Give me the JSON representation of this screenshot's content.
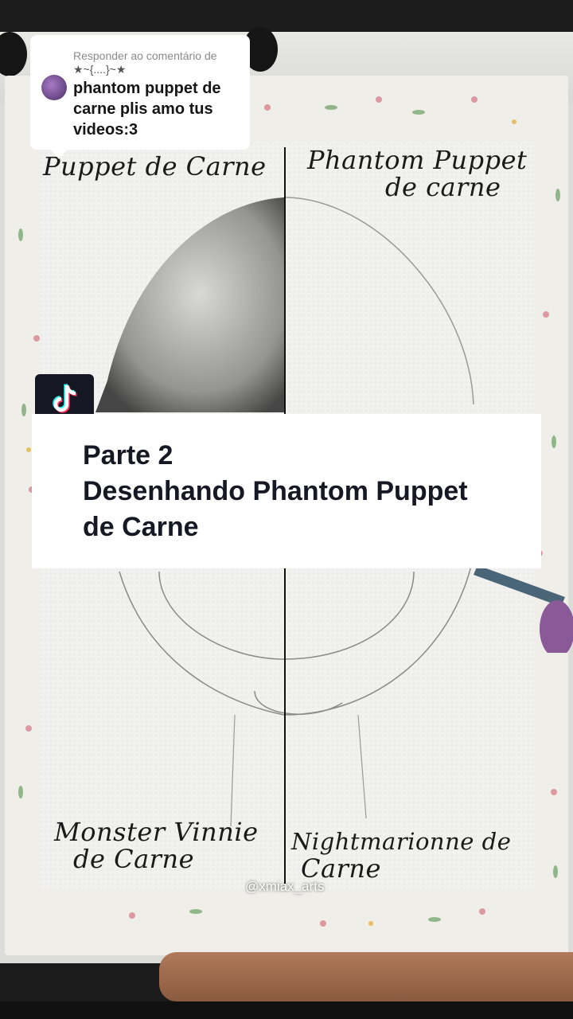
{
  "comment": {
    "reply_label": "Responder ao comentário de",
    "reply_user": "★~{....}~★",
    "text": "phantom puppet de carne plis amo tus videos:3"
  },
  "drawing_labels": {
    "top_left": "Puppet de Carne",
    "top_right_line1": "Phantom Puppet",
    "top_right_line2": "de carne",
    "bottom_left_line1": "Monster Vinnie",
    "bottom_left_line2": "de Carne",
    "bottom_right_line1": "Nightmarionne de",
    "bottom_right_line2": "Carne"
  },
  "caption": {
    "line1": "Parte 2",
    "line2": "Desenhando Phantom Puppet",
    "line3": "de Carne"
  },
  "watermark": "@xmiax_arts",
  "icons": {
    "logo": "tiktok-logo-icon"
  }
}
